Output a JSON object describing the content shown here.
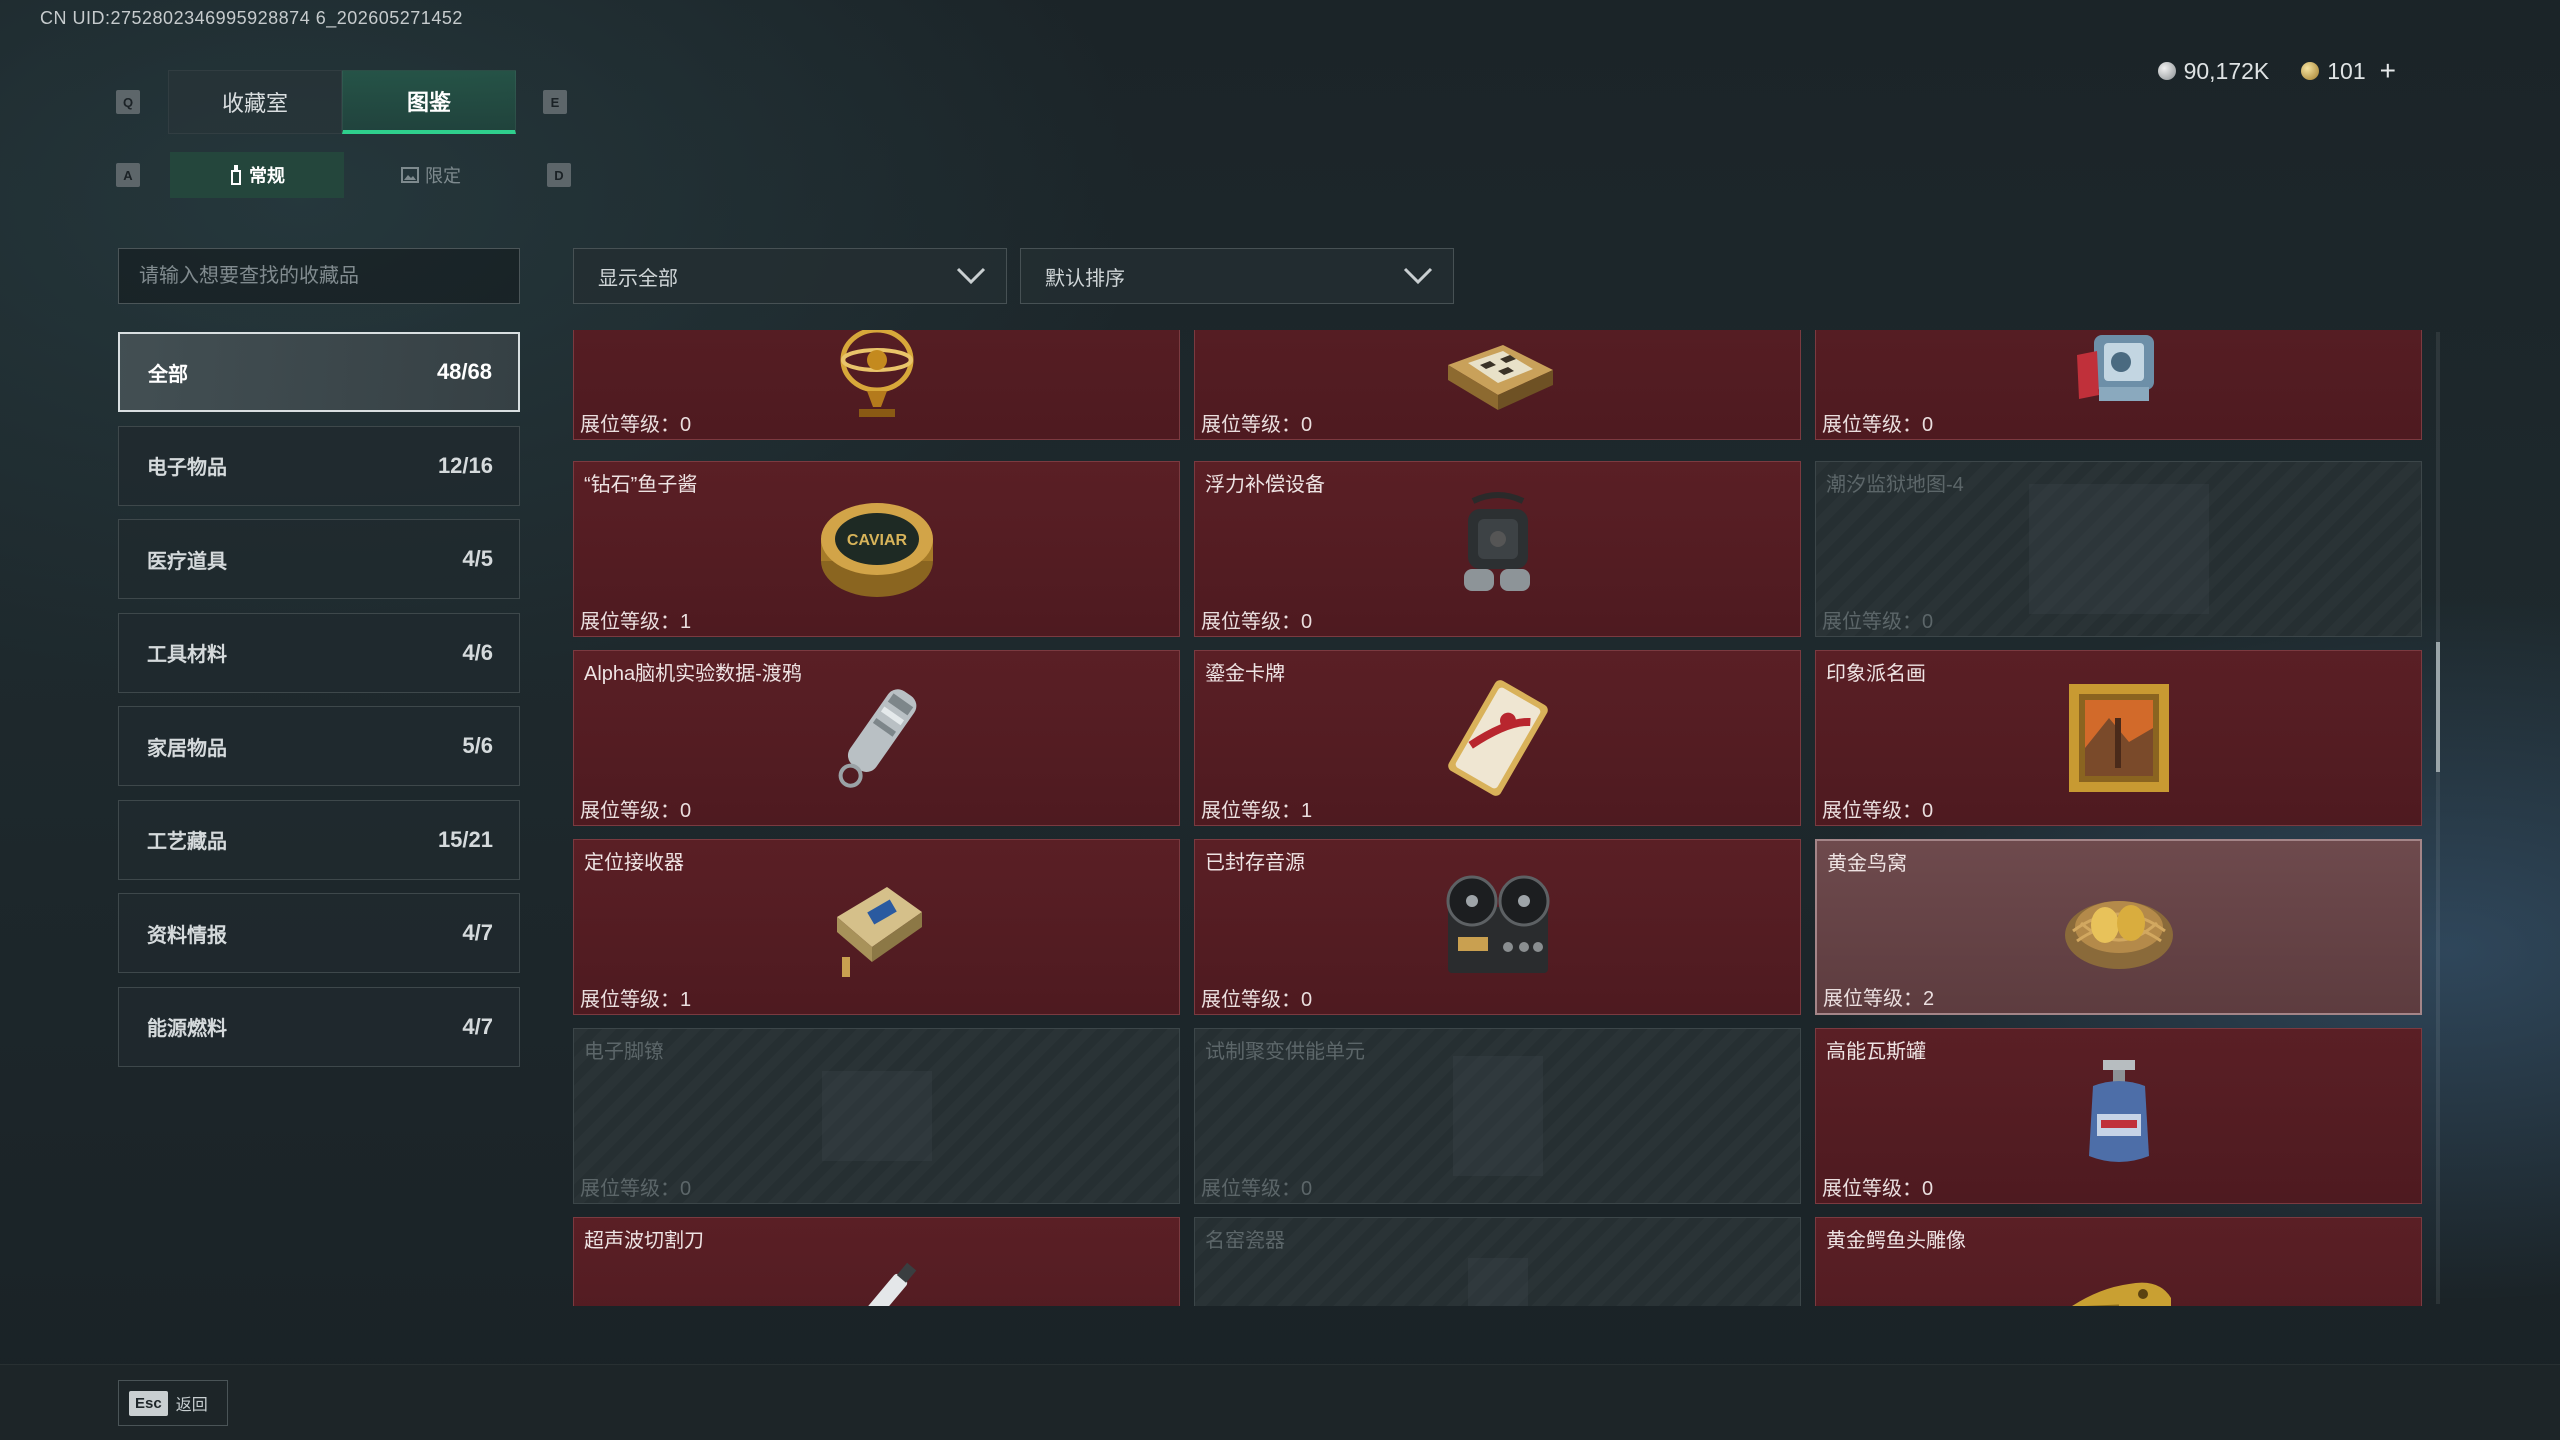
{
  "header": {
    "uid": "CN UID:2752802346995928874 6_202605271452",
    "tabs": [
      "收藏室",
      "图鉴"
    ],
    "subtabs": [
      "常规",
      "限定"
    ],
    "keys": {
      "left_tab": "Q",
      "right_tab": "E",
      "left_sub": "A",
      "right_sub": "D"
    }
  },
  "currency": {
    "silver": "90,172K",
    "gold": "101",
    "add_label": "+"
  },
  "search": {
    "placeholder": "请输入想要查找的收藏品"
  },
  "filters": {
    "show": "显示全部",
    "sort": "默认排序"
  },
  "categories": [
    {
      "label": "全部",
      "count": "48/68"
    },
    {
      "label": "电子物品",
      "count": "12/16"
    },
    {
      "label": "医疗道具",
      "count": "4/5"
    },
    {
      "label": "工具材料",
      "count": "4/6"
    },
    {
      "label": "家居物品",
      "count": "5/6"
    },
    {
      "label": "工艺藏品",
      "count": "15/21"
    },
    {
      "label": "资料情报",
      "count": "4/7"
    },
    {
      "label": "能源燃料",
      "count": "4/7"
    }
  ],
  "items": [
    {
      "name": "",
      "level": "展位等级：0",
      "icon": "armillary-sphere-icon"
    },
    {
      "name": "",
      "level": "展位等级：0",
      "icon": "chess-box-icon"
    },
    {
      "name": "",
      "level": "展位等级：0",
      "icon": "machine-part-icon"
    },
    {
      "name": "“钻石”鱼子酱",
      "level": "展位等级：1",
      "icon": "caviar-tin-icon",
      "tin_text": "CAVIAR"
    },
    {
      "name": "浮力补偿设备",
      "level": "展位等级：0",
      "icon": "diving-gear-icon"
    },
    {
      "name": "潮汐监狱地图-4",
      "level": "展位等级：0",
      "icon": "map-icon"
    },
    {
      "name": "Alpha脑机实验数据-渡鸦",
      "level": "展位等级：0",
      "icon": "usb-drive-icon"
    },
    {
      "name": "鎏金卡牌",
      "level": "展位等级：1",
      "icon": "gilded-card-icon"
    },
    {
      "name": "印象派名画",
      "level": "展位等级：0",
      "icon": "framed-painting-icon"
    },
    {
      "name": "定位接收器",
      "level": "展位等级：1",
      "icon": "gps-receiver-icon"
    },
    {
      "name": "已封存音源",
      "level": "展位等级：0",
      "icon": "reel-recorder-icon"
    },
    {
      "name": "黄金鸟窝",
      "level": "展位等级：2",
      "icon": "golden-nest-icon"
    },
    {
      "name": "电子脚镣",
      "level": "展位等级：0",
      "icon": "ankle-monitor-icon"
    },
    {
      "name": "试制聚变供能单元",
      "level": "展位等级：0",
      "icon": "fusion-cell-icon"
    },
    {
      "name": "高能瓦斯罐",
      "level": "展位等级：0",
      "icon": "gas-canister-icon"
    },
    {
      "name": "超声波切割刀",
      "level": "",
      "icon": "cutter-knife-icon"
    },
    {
      "name": "名窑瓷器",
      "level": "",
      "icon": "porcelain-icon"
    },
    {
      "name": "黄金鳄鱼头雕像",
      "level": "",
      "icon": "crocodile-statue-icon"
    }
  ],
  "footer": {
    "esc_key": "Esc",
    "back_label": "返回"
  }
}
